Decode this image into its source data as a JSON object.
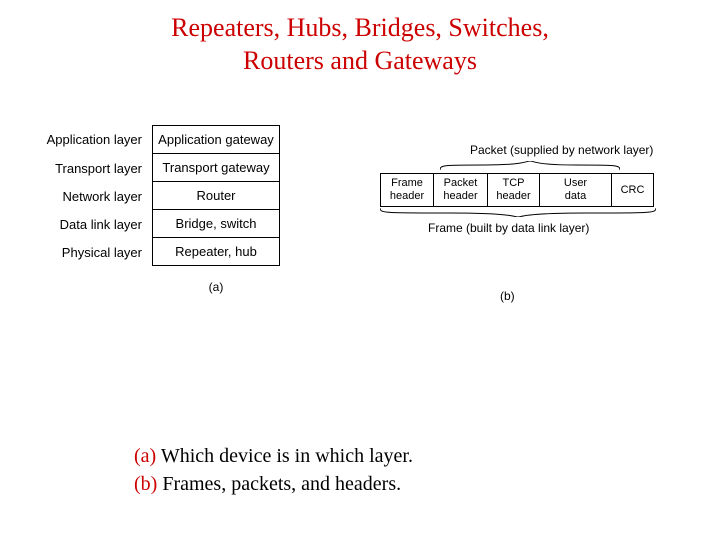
{
  "title_line1": "Repeaters, Hubs, Bridges, Switches,",
  "title_line2": "Routers and Gateways",
  "part_a": {
    "rows": [
      {
        "layer": "Application layer",
        "device": "Application gateway"
      },
      {
        "layer": "Transport layer",
        "device": "Transport gateway"
      },
      {
        "layer": "Network layer",
        "device": "Router"
      },
      {
        "layer": "Data link layer",
        "device": "Bridge, switch"
      },
      {
        "layer": "Physical layer",
        "device": "Repeater, hub"
      }
    ],
    "label": "(a)"
  },
  "part_b": {
    "packet_label": "Packet (supplied by network layer)",
    "cells": {
      "frame_header_l1": "Frame",
      "frame_header_l2": "header",
      "packet_header_l1": "Packet",
      "packet_header_l2": "header",
      "tcp_header_l1": "TCP",
      "tcp_header_l2": "header",
      "user_data_l1": "User",
      "user_data_l2": "data",
      "crc": "CRC"
    },
    "frame_label": "Frame (built by data link layer)",
    "label": "(b)"
  },
  "captions": {
    "a_letter": "(a)",
    "a_text": " Which device is in which layer.",
    "b_letter": "(b)",
    "b_text": " Frames, packets, and headers."
  }
}
